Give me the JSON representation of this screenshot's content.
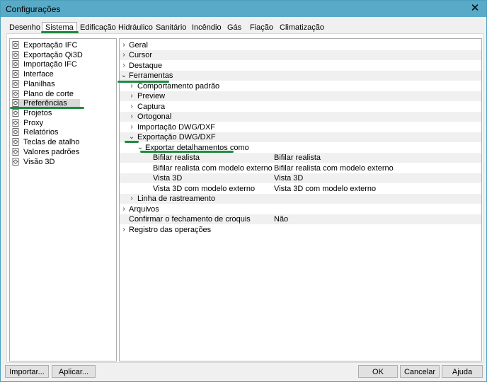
{
  "window": {
    "title": "Configurações",
    "close_glyph": "✕"
  },
  "tabs": [
    "Desenho",
    "Sistema",
    "Edificação",
    "Hidráulico",
    "Sanitário",
    "Incêndio",
    "Gás",
    "Fiação",
    "Climatização"
  ],
  "active_tab": "Sistema",
  "left_items": [
    "Exportação IFC",
    "Exportação Qi3D",
    "Importação IFC",
    "Interface",
    "Planilhas",
    "Plano de corte",
    "Preferências",
    "Projetos",
    "Proxy",
    "Relatórios",
    "Teclas de atalho",
    "Valores padrões",
    "Visão 3D"
  ],
  "selected_left": "Preferências",
  "tree": [
    {
      "label": "Geral",
      "expander": "›"
    },
    {
      "label": "Cursor",
      "expander": "›"
    },
    {
      "label": "Destaque",
      "expander": "›"
    },
    {
      "label": "Ferramentas",
      "expander": "⌄"
    },
    {
      "label": "Comportamento padrão",
      "expander": "›"
    },
    {
      "label": "Preview",
      "expander": "›"
    },
    {
      "label": "Captura",
      "expander": "›"
    },
    {
      "label": "Ortogonal",
      "expander": "›"
    },
    {
      "label": "Importação DWG/DXF",
      "expander": "›"
    },
    {
      "label": "Exportação DWG/DXF",
      "expander": "⌄"
    },
    {
      "label": "Exportar detalhamentos como",
      "expander": "⌄"
    },
    {
      "label": "Bifilar realista",
      "value": "Bifilar realista"
    },
    {
      "label": "Bifilar realista com modelo externo",
      "value": "Bifilar realista com modelo externo"
    },
    {
      "label": "Vista 3D",
      "value": "Vista 3D"
    },
    {
      "label": "Vista 3D com modelo externo",
      "value": "Vista 3D com modelo externo"
    },
    {
      "label": "Linha de rastreamento",
      "expander": "›"
    },
    {
      "label": "Arquivos",
      "expander": "›"
    },
    {
      "label": "Confirmar o fechamento de croquis",
      "value": "Não"
    },
    {
      "label": "Registro das operações",
      "expander": "›"
    }
  ],
  "buttons": {
    "import": "Importar...",
    "apply": "Aplicar...",
    "ok": "OK",
    "cancel": "Cancelar",
    "help": "Ajuda"
  },
  "colors": {
    "titlebar": "#58aac7",
    "highlight_underline": "#1f8a3f",
    "selected_item": "#d9d9d9"
  },
  "icons": {
    "left_item_icon": "settings-document-icon"
  }
}
